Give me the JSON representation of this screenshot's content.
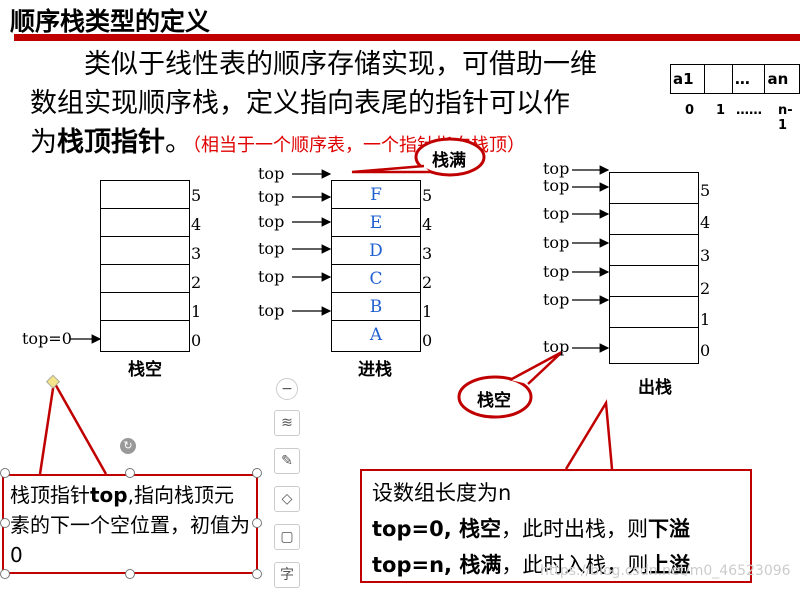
{
  "title": "顺序栈类型的定义",
  "intro": {
    "line1": "类似于线性表的顺序存储实现，可借助一维",
    "line2": "数组实现顺序栈，定义指向表尾的指针可以作",
    "line3_prefix": "为",
    "line3_bold": "栈顶指针",
    "line3_suffix": "。",
    "note": "（相当于一个顺序表，一个指针指向栈顶）"
  },
  "array_fig": {
    "cells": [
      "a1",
      "",
      "…",
      "an"
    ],
    "indices": [
      "0",
      "1",
      "……",
      "n-1"
    ]
  },
  "stack_empty": {
    "caption": "栈空",
    "pointer": "top=0",
    "indices": [
      "5",
      "4",
      "3",
      "2",
      "1",
      "0"
    ]
  },
  "stack_push": {
    "caption": "进栈",
    "bubble": "栈满",
    "cells": [
      "F",
      "E",
      "D",
      "C",
      "B",
      "A"
    ],
    "indices": [
      "5",
      "4",
      "3",
      "2",
      "1",
      "0"
    ],
    "pointer": "top"
  },
  "stack_pop": {
    "caption": "出栈",
    "bubble": "栈空",
    "indices": [
      "5",
      "4",
      "3",
      "2",
      "1",
      "0"
    ],
    "pointer": "top"
  },
  "box_left": {
    "p1": "栈顶指针",
    "p1_bold": "top",
    "p2": ",指向栈顶元素的下一个空位置，初值为0"
  },
  "box_right": {
    "line1": "设数组长度为n",
    "line2_bold": "top=0, 栈空",
    "line2_mid": "，此时出栈，则",
    "line2_end": "下溢",
    "line3_bold": "top=n, 栈满",
    "line3_mid": "，此时入栈，则",
    "line3_end": "上溢"
  },
  "watermark": "https://blog.csdn.net/m0_46523096",
  "colors": {
    "accent": "#c00000",
    "cell_text": "#2060d0",
    "note": "#e00000"
  }
}
